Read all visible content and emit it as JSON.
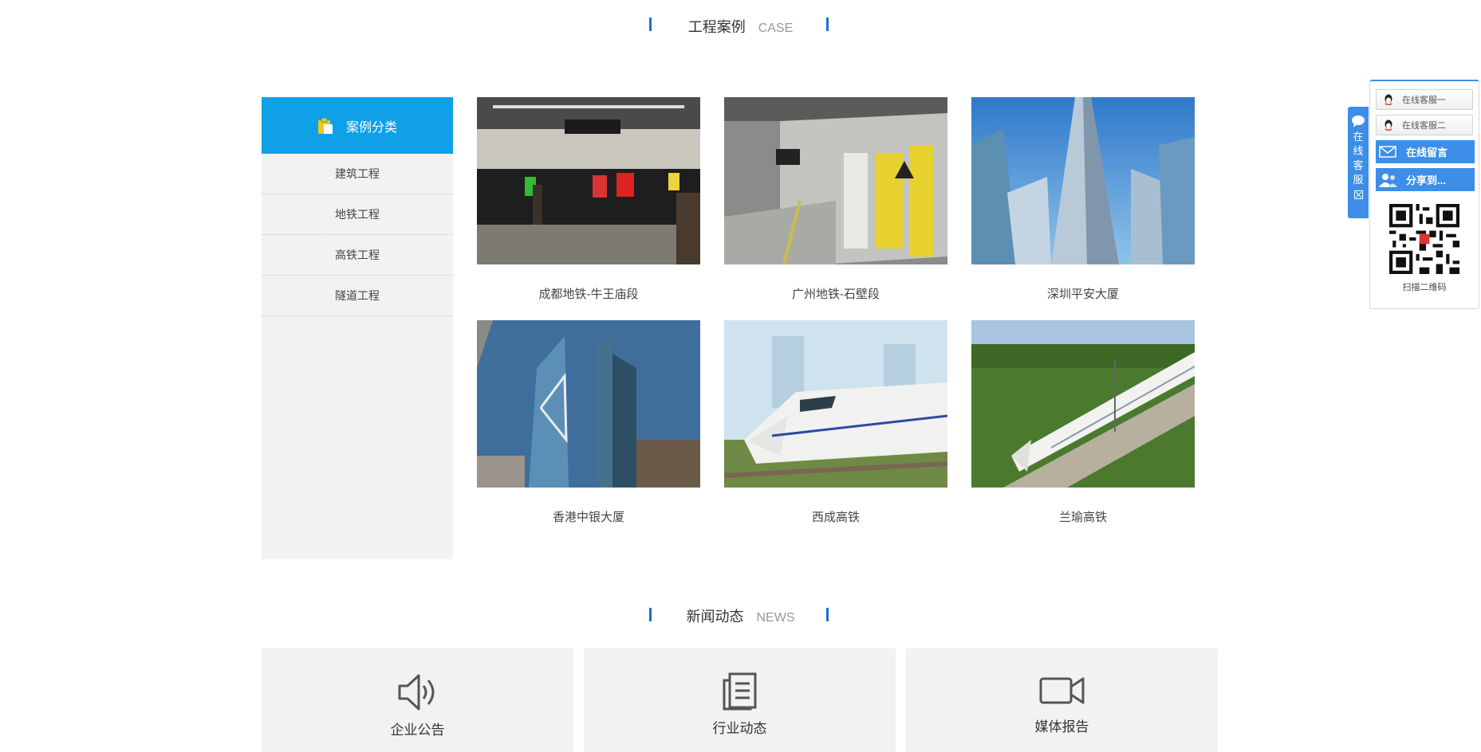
{
  "cases_section": {
    "title": "工程案例",
    "title_en": "CASE"
  },
  "sidebar": {
    "heading": "案例分类",
    "items": [
      {
        "label": "建筑工程"
      },
      {
        "label": "地铁工程"
      },
      {
        "label": "高铁工程"
      },
      {
        "label": "隧道工程"
      }
    ]
  },
  "cases": [
    {
      "caption": "成都地铁-牛王庙段"
    },
    {
      "caption": "广州地铁-石壁段"
    },
    {
      "caption": "深圳平安大厦"
    },
    {
      "caption": "香港中银大厦"
    },
    {
      "caption": "西成高铁"
    },
    {
      "caption": "兰瑜高铁"
    }
  ],
  "news_section": {
    "title": "新闻动态",
    "title_en": "NEWS"
  },
  "news_cards": [
    {
      "label": "企业公告",
      "icon": "speaker-icon"
    },
    {
      "label": "行业动态",
      "icon": "document-icon"
    },
    {
      "label": "媒体报告",
      "icon": "video-camera-icon"
    }
  ],
  "float_service": {
    "tab_chars": [
      "在",
      "线",
      "客",
      "服"
    ],
    "qq1": "在线客服一",
    "qq2": "在线客服二",
    "message": "在线留言",
    "share": "分享到...",
    "qr_label": "扫描二维码"
  },
  "colors": {
    "accent": "#0fa0e8",
    "bar": "#1e6fd0",
    "float_blue": "#3d8ee8"
  }
}
